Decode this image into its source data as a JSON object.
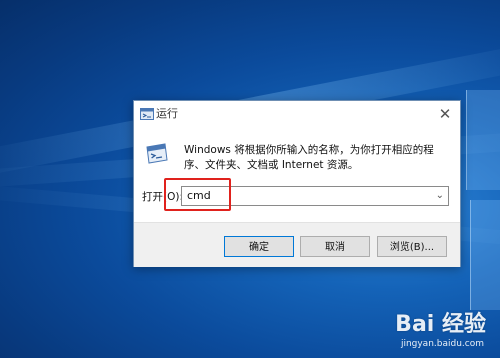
{
  "dialog": {
    "title": "运行",
    "description": "Windows 将根据你所输入的名称，为你打开相应的程序、文件夹、文档或 Internet 资源。",
    "open_label": "打开(O):",
    "open_value": "cmd",
    "buttons": {
      "ok": "确定",
      "cancel": "取消",
      "browse": "浏览(B)..."
    },
    "close_glyph": "✕"
  },
  "watermark": {
    "brand": "Bai 经验",
    "url": "jingyan.baidu.com"
  },
  "colors": {
    "highlight": "#e0221d",
    "desktop": "#0b4b9c"
  },
  "icons": [
    "run-icon",
    "run-large-icon",
    "close-icon",
    "chevron-down-icon",
    "baidu-paw-icon"
  ]
}
